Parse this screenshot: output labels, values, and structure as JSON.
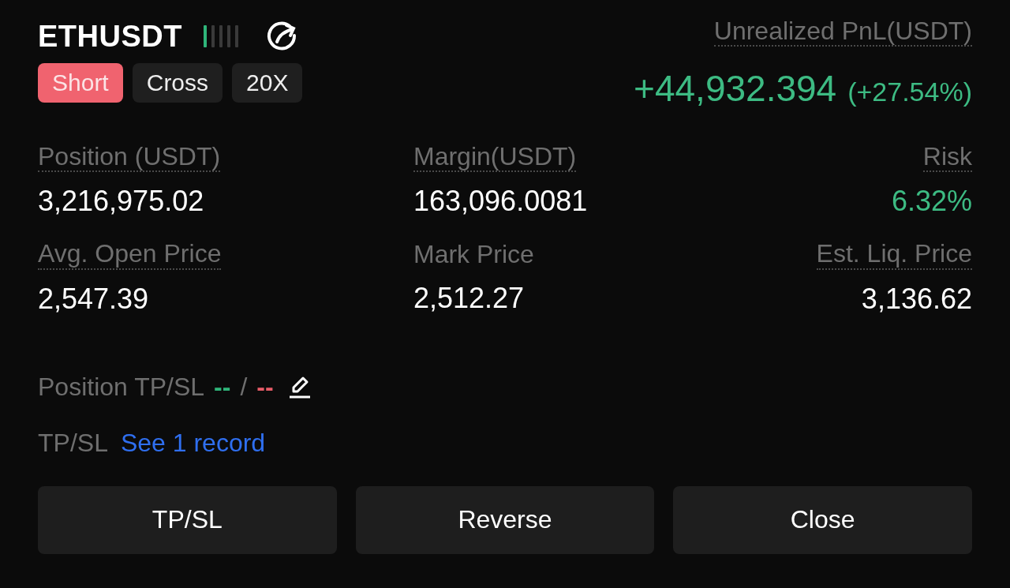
{
  "symbol": "ETHUSDT",
  "risk_meter": {
    "level": 0.2
  },
  "tags": [
    {
      "label": "Short",
      "kind": "side"
    },
    {
      "label": "Cross",
      "kind": "plain"
    },
    {
      "label": "20X",
      "kind": "plain"
    }
  ],
  "pnl": {
    "label": "Unrealized PnL(USDT)",
    "value": "+44,932.394",
    "percent": "(+27.54%)"
  },
  "stats": [
    {
      "label": "Position (USDT)",
      "value": "3,216,975.02",
      "underlined": true,
      "positive": false
    },
    {
      "label": "Margin(USDT)",
      "value": "163,096.0081",
      "underlined": true,
      "positive": false
    },
    {
      "label": "Risk",
      "value": "6.32%",
      "underlined": true,
      "positive": true
    },
    {
      "label": "Avg. Open Price",
      "value": "2,547.39",
      "underlined": true,
      "positive": false
    },
    {
      "label": "Mark Price",
      "value": "2,512.27",
      "underlined": false,
      "positive": false
    },
    {
      "label": "Est. Liq. Price",
      "value": "3,136.62",
      "underlined": true,
      "positive": false
    }
  ],
  "position_tpsl": {
    "label": "Position TP/SL",
    "tp": "--",
    "separator": "/",
    "sl": "--"
  },
  "tpsl": {
    "label": "TP/SL",
    "link": "See 1 record"
  },
  "buttons": [
    "TP/SL",
    "Reverse",
    "Close"
  ]
}
